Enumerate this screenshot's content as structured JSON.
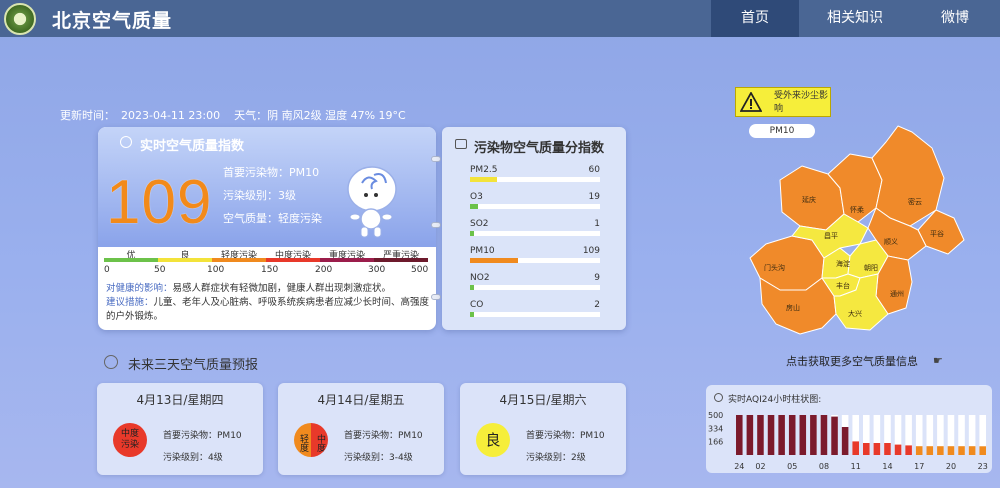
{
  "header": {
    "title": "北京空气质量",
    "nav": [
      "首页",
      "相关知识",
      "微博"
    ]
  },
  "update": {
    "label": "更新时间：",
    "time": "2023-04-11 23:00",
    "weather": "天气：阴 南风2级 湿度 47% 19°C"
  },
  "aqi": {
    "title": "实时空气质量指数",
    "value": "109",
    "primary": "首要污染物：PM10",
    "level": "污染级别：3级",
    "quality": "空气质量：轻度污染",
    "scale_labels": [
      "优",
      "良",
      "轻度污染",
      "中度污染",
      "重度污染",
      "严重污染"
    ],
    "scale_colors": [
      "#6cc24a",
      "#f3e33a",
      "#f08a1e",
      "#e8392a",
      "#9b1d4b",
      "#6d1a2c"
    ],
    "scale_nums": [
      "0",
      "50",
      "100",
      "150",
      "200",
      "300",
      "500"
    ],
    "health_label": "对健康的影响：",
    "health_text": "易感人群症状有轻微加剧，健康人群出现刺激症状。",
    "advice_label": "建议措施：",
    "advice_text": "儿童、老年人及心脏病、呼吸系统疾病患者应减少长时间、高强度的户外锻炼。"
  },
  "pollutants": {
    "title": "污染物空气质量分指数",
    "items": [
      {
        "name": "PM2.5",
        "value": 60,
        "color": "#f3e33a"
      },
      {
        "name": "O3",
        "value": 19,
        "color": "#6cc24a"
      },
      {
        "name": "SO2",
        "value": 1,
        "color": "#6cc24a"
      },
      {
        "name": "PM10",
        "value": 109,
        "color": "#f08a1e"
      },
      {
        "name": "NO2",
        "value": 9,
        "color": "#6cc24a"
      },
      {
        "name": "CO",
        "value": 2,
        "color": "#6cc24a"
      }
    ]
  },
  "forecast": {
    "title": "未来三天空气质量预报",
    "days": [
      {
        "date": "4月13日/星期四",
        "badge": "中度\n污染",
        "primary": "首要污染物：PM10",
        "level": "污染级别：4级"
      },
      {
        "date": "4月14日/星期五",
        "badge_left": "轻度",
        "badge_right": "中度",
        "primary": "首要污染物：PM10",
        "level": "污染级别：3-4级"
      },
      {
        "date": "4月15日/星期六",
        "badge": "良",
        "primary": "首要污染物：PM10",
        "level": "污染级别：2级"
      }
    ]
  },
  "map": {
    "dust_text": "受外来沙尘影响",
    "tag": "PM10",
    "cta": "点击获取更多空气质量信息",
    "districts": [
      "延庆",
      "怀柔",
      "密云",
      "昌平",
      "顺义",
      "平谷",
      "门头沟",
      "海淀",
      "朝阳",
      "通州",
      "丰台",
      "房山",
      "大兴"
    ]
  },
  "hourly": {
    "title": "实时AQI24小时柱状图:",
    "yticks": [
      "500",
      "334",
      "166"
    ],
    "xticks": [
      "24",
      "02",
      "05",
      "08",
      "11",
      "14",
      "17",
      "20",
      "23"
    ]
  },
  "chart_data": {
    "type": "bar",
    "title": "实时AQI24小时柱状图:",
    "categories": [
      "24",
      "01",
      "02",
      "03",
      "04",
      "05",
      "06",
      "07",
      "08",
      "09",
      "10",
      "11",
      "12",
      "13",
      "14",
      "15",
      "16",
      "17",
      "18",
      "19",
      "20",
      "21",
      "22",
      "23"
    ],
    "values": [
      500,
      500,
      500,
      500,
      500,
      500,
      500,
      500,
      500,
      480,
      350,
      170,
      150,
      150,
      150,
      130,
      120,
      110,
      110,
      110,
      110,
      110,
      110,
      109
    ],
    "ylim": [
      0,
      500
    ],
    "colors_by_level": {
      "serious": "#7b1a2c",
      "heavy": "#9b1d4b",
      "moderate": "#e8392a",
      "light": "#f08a1e"
    }
  }
}
